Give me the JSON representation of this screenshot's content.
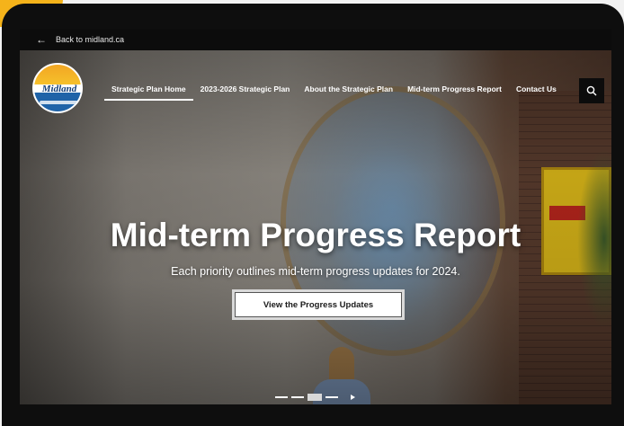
{
  "topbar": {
    "back_arrow_icon": "arrow-left-icon",
    "back_label": "Back to midland.ca"
  },
  "logo": {
    "text": "Midland"
  },
  "nav": {
    "items": [
      {
        "label": "Strategic Plan Home",
        "active": true
      },
      {
        "label": "2023-2026 Strategic Plan",
        "active": false
      },
      {
        "label": "About the Strategic Plan",
        "active": false
      },
      {
        "label": "Mid-term Progress Report",
        "active": false
      },
      {
        "label": "Contact Us",
        "active": false
      }
    ],
    "search_icon": "search-icon"
  },
  "hero": {
    "title": "Mid-term Progress Report",
    "subtitle": "Each priority outlines mid-term progress updates for 2024.",
    "cta_label": "View the Progress Updates"
  },
  "carousel": {
    "slide_count": 4,
    "active_index": 2,
    "play_icon": "play-icon"
  },
  "colors": {
    "accent": "#f5b31a",
    "device": "#0e0e0e",
    "nav_text": "#ffffff"
  }
}
